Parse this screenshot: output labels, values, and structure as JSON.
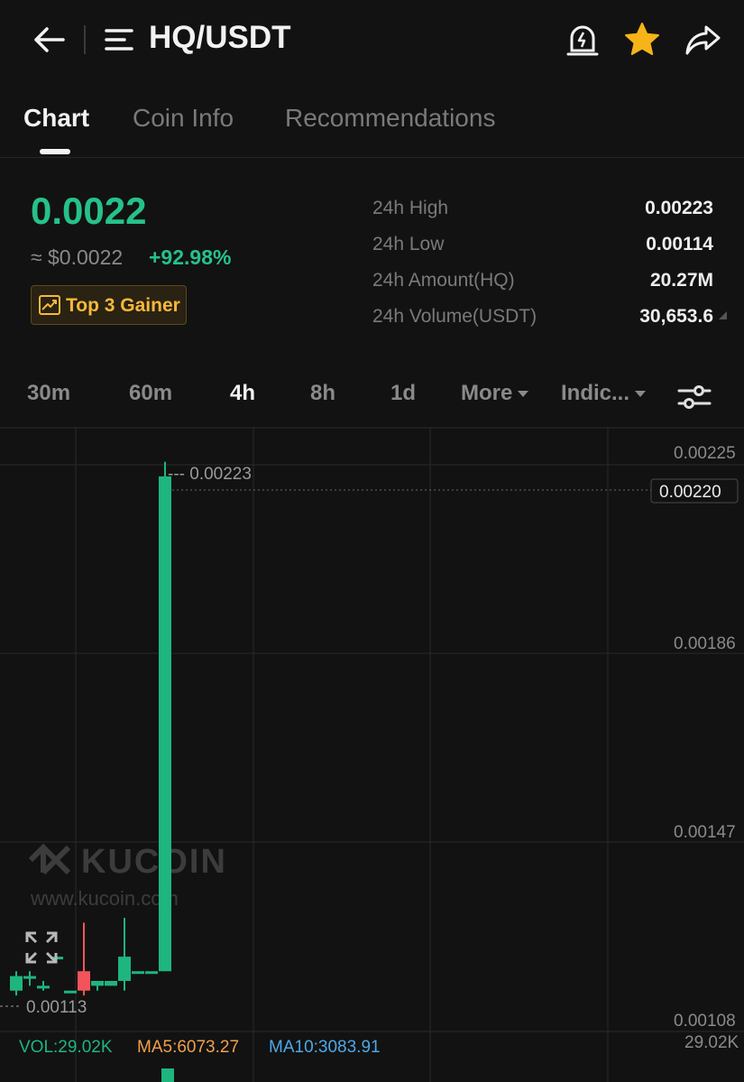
{
  "header": {
    "pair": "HQ/USDT",
    "icons": {
      "back": "back-arrow-icon",
      "menu": "menu-icon",
      "alert": "price-alert-icon",
      "favorite": "star-icon",
      "share": "share-icon"
    },
    "favorite_color": "#f6b418"
  },
  "tabs": [
    {
      "label": "Chart",
      "active": true
    },
    {
      "label": "Coin Info",
      "active": false
    },
    {
      "label": "Recommendations",
      "active": false
    }
  ],
  "ticker": {
    "price": "0.0022",
    "usd_price": "≈ $0.0022",
    "change": "+92.98%",
    "badge": "Top 3 Gainer",
    "up_color": "#25c28a"
  },
  "stats": [
    {
      "label": "24h High",
      "value": "0.00223"
    },
    {
      "label": "24h Low",
      "value": "0.00114"
    },
    {
      "label": "24h Amount(HQ)",
      "value": "20.27M"
    },
    {
      "label": "24h Volume(USDT)",
      "value": "30,653.6"
    }
  ],
  "intervals": [
    {
      "label": "30m",
      "active": false
    },
    {
      "label": "60m",
      "active": false
    },
    {
      "label": "4h",
      "active": true
    },
    {
      "label": "8h",
      "active": false
    },
    {
      "label": "1d",
      "active": false
    },
    {
      "label": "More",
      "active": false,
      "dropdown": true
    },
    {
      "label": "Indic...",
      "active": false,
      "dropdown": true
    }
  ],
  "chart": {
    "watermark_brand": "KUCOIN",
    "watermark_url": "www.kucoin.com",
    "y_ticks": [
      "0.00225",
      "0.00186",
      "0.00147",
      "0.00108"
    ],
    "current_price_tag": "0.00220",
    "high_marker": "--- 0.00223",
    "low_marker": "0.00113",
    "volume_axis_label": "29.02K",
    "volume_stats": {
      "vol": "VOL:29.02K",
      "ma5": "MA5:6073.27",
      "ma10": "MA10:3083.91"
    },
    "up_color": "#1fb57f",
    "down_color": "#f2545b"
  },
  "chart_data": {
    "type": "candlestick",
    "title": "",
    "xlabel": "",
    "ylabel": "",
    "ylim": [
      0.00108,
      0.00225
    ],
    "grid": true,
    "candles": [
      {
        "open": 0.00114,
        "high": 0.00118,
        "low": 0.00113,
        "close": 0.00117,
        "dir": "up"
      },
      {
        "open": 0.00117,
        "high": 0.00118,
        "low": 0.00115,
        "close": 0.00117,
        "dir": "up"
      },
      {
        "open": 0.00115,
        "high": 0.00116,
        "low": 0.00114,
        "close": 0.00115,
        "dir": "up"
      },
      {
        "open": 0.00121,
        "high": 0.00121,
        "low": 0.00121,
        "close": 0.00121,
        "dir": "up"
      },
      {
        "open": 0.00114,
        "high": 0.00114,
        "low": 0.00114,
        "close": 0.00114,
        "dir": "up"
      },
      {
        "open": 0.00118,
        "high": 0.00128,
        "low": 0.00113,
        "close": 0.00114,
        "dir": "down"
      },
      {
        "open": 0.00115,
        "high": 0.00116,
        "low": 0.00114,
        "close": 0.00116,
        "dir": "up"
      },
      {
        "open": 0.00115,
        "high": 0.00116,
        "low": 0.00115,
        "close": 0.00116,
        "dir": "up"
      },
      {
        "open": 0.00116,
        "high": 0.00129,
        "low": 0.00114,
        "close": 0.00121,
        "dir": "up"
      },
      {
        "open": 0.00118,
        "high": 0.00118,
        "low": 0.00118,
        "close": 0.00118,
        "dir": "up"
      },
      {
        "open": 0.00118,
        "high": 0.00118,
        "low": 0.00118,
        "close": 0.00118,
        "dir": "up"
      },
      {
        "open": 0.00118,
        "high": 0.00223,
        "low": 0.00118,
        "close": 0.0022,
        "dir": "up"
      }
    ]
  }
}
